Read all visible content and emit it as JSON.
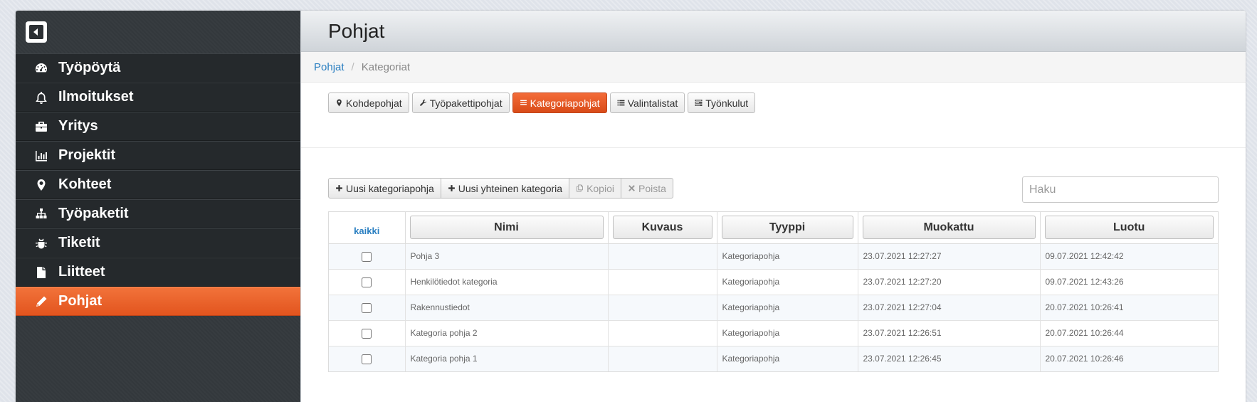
{
  "sidebar": {
    "items": [
      {
        "label": "Työpöytä",
        "icon": "dashboard-icon",
        "active": false
      },
      {
        "label": "Ilmoitukset",
        "icon": "bell-icon",
        "active": false
      },
      {
        "label": "Yritys",
        "icon": "briefcase-icon",
        "active": false
      },
      {
        "label": "Projektit",
        "icon": "bar-chart-icon",
        "active": false
      },
      {
        "label": "Kohteet",
        "icon": "map-marker-icon",
        "active": false
      },
      {
        "label": "Työpaketit",
        "icon": "sitemap-icon",
        "active": false
      },
      {
        "label": "Tiketit",
        "icon": "bug-icon",
        "active": false
      },
      {
        "label": "Liitteet",
        "icon": "file-icon",
        "active": false
      },
      {
        "label": "Pohjat",
        "icon": "pencil-icon",
        "active": true
      }
    ]
  },
  "header": {
    "title": "Pohjat"
  },
  "breadcrumb": {
    "parent": "Pohjat",
    "separator": "/",
    "current": "Kategoriat"
  },
  "tabs": [
    {
      "label": "Kohdepohjat",
      "icon": "map-marker-icon",
      "active": false
    },
    {
      "label": "Työpakettipohjat",
      "icon": "wrench-icon",
      "active": false
    },
    {
      "label": "Kategoriapohjat",
      "icon": "list-icon",
      "active": true
    },
    {
      "label": "Valintalistat",
      "icon": "list-icon",
      "active": false
    },
    {
      "label": "Työnkulut",
      "icon": "tasks-icon",
      "active": false
    }
  ],
  "actions": {
    "new_template": "Uusi kategoriapohja",
    "new_shared": "Uusi yhteinen kategoria",
    "copy": "Kopioi",
    "delete": "Poista"
  },
  "search": {
    "placeholder": "Haku",
    "value": ""
  },
  "table": {
    "select_all": "kaikki",
    "columns": [
      "Nimi",
      "Kuvaus",
      "Tyyppi",
      "Muokattu",
      "Luotu"
    ],
    "rows": [
      {
        "name": "Pohja 3",
        "description": "",
        "type": "Kategoriapohja",
        "modified": "23.07.2021 12:27:27",
        "created": "09.07.2021 12:42:42"
      },
      {
        "name": "Henkilötiedot kategoria",
        "description": "",
        "type": "Kategoriapohja",
        "modified": "23.07.2021 12:27:20",
        "created": "09.07.2021 12:43:26"
      },
      {
        "name": "Rakennustiedot",
        "description": "",
        "type": "Kategoriapohja",
        "modified": "23.07.2021 12:27:04",
        "created": "20.07.2021 10:26:41"
      },
      {
        "name": "Kategoria pohja 2",
        "description": "",
        "type": "Kategoriapohja",
        "modified": "23.07.2021 12:26:51",
        "created": "20.07.2021 10:26:44"
      },
      {
        "name": "Kategoria pohja 1",
        "description": "",
        "type": "Kategoriapohja",
        "modified": "23.07.2021 12:26:45",
        "created": "20.07.2021 10:26:46"
      }
    ]
  },
  "colors": {
    "accent": "#e95a24",
    "sidebar_bg": "#25292c",
    "link": "#2a7fc1"
  }
}
